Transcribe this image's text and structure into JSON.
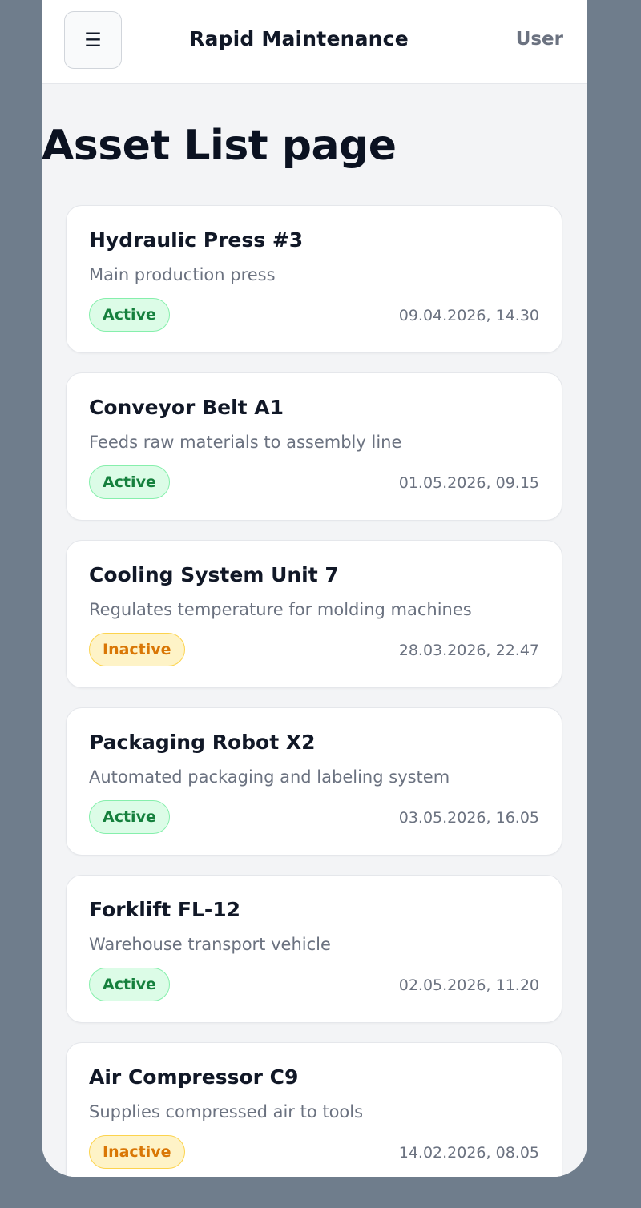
{
  "header": {
    "menu_icon": "☰",
    "app_title": "Rapid Maintenance",
    "user_label": "User"
  },
  "page": {
    "title": "Asset List page"
  },
  "colors": {
    "active_bg": "#dcfce7",
    "active_text": "#15803d",
    "inactive_bg": "#fef3c7",
    "inactive_text": "#d97706",
    "background": "#6f7d8c"
  },
  "assets": [
    {
      "name": "Hydraulic Press #3",
      "description": "Main production press",
      "status": "Active",
      "timestamp": "09.04.2026, 14.30"
    },
    {
      "name": "Conveyor Belt A1",
      "description": "Feeds raw materials to assembly line",
      "status": "Active",
      "timestamp": "01.05.2026, 09.15"
    },
    {
      "name": "Cooling System Unit 7",
      "description": "Regulates temperature for molding machines",
      "status": "Inactive",
      "timestamp": "28.03.2026, 22.47"
    },
    {
      "name": "Packaging Robot X2",
      "description": "Automated packaging and labeling system",
      "status": "Active",
      "timestamp": "03.05.2026, 16.05"
    },
    {
      "name": "Forklift FL-12",
      "description": "Warehouse transport vehicle",
      "status": "Active",
      "timestamp": "02.05.2026, 11.20"
    },
    {
      "name": "Air Compressor C9",
      "description": "Supplies compressed air to tools",
      "status": "Inactive",
      "timestamp": "14.02.2026, 08.05"
    }
  ]
}
